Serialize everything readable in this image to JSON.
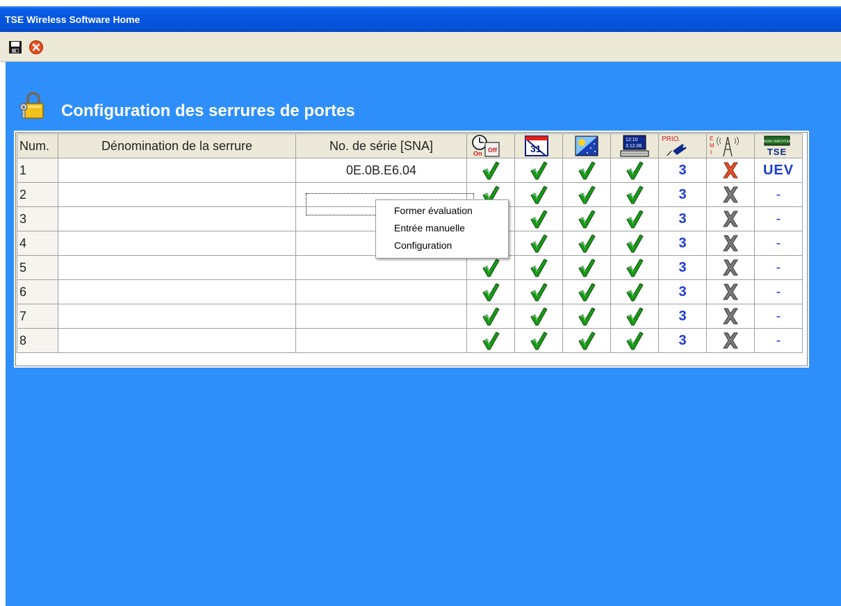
{
  "window": {
    "title": "TSE Wireless Software Home"
  },
  "toolbar": {
    "save_icon": "floppy-disk-icon",
    "close_icon": "close-circle-icon"
  },
  "page": {
    "title": "Configuration des serrures de portes",
    "icon": "padlock-keys-icon"
  },
  "table": {
    "headers": {
      "num": "Num.",
      "name": "Dénomination de la serrure",
      "serial": "No. de série [SNA]",
      "icon_columns": [
        "clock-on-off-icon",
        "calendar-31-icon",
        "sun-night-icon",
        "datetime-display-icon",
        "prio-tag-icon",
        "emi-antenna-icon",
        "tse-badge-icon"
      ],
      "prio_label": "PRIO.",
      "datetime_label_time": "12:10",
      "datetime_label_date": "3.12.06",
      "emi_label": "E\nM\nI",
      "tse_badge_top": "BURG WÄCHTER",
      "tse_label": "TSE",
      "clock_on": "On",
      "clock_off": "Off",
      "calendar_day": "31"
    },
    "rows": [
      {
        "num": "1",
        "name": "",
        "serial": "0E.0B.E6.04",
        "prio": "3",
        "emi_active": true,
        "tse": "UEV"
      },
      {
        "num": "2",
        "name": "",
        "serial": "",
        "prio": "3",
        "emi_active": false,
        "tse": "-"
      },
      {
        "num": "3",
        "name": "",
        "serial": "",
        "prio": "3",
        "emi_active": false,
        "tse": "-"
      },
      {
        "num": "4",
        "name": "",
        "serial": "",
        "prio": "3",
        "emi_active": false,
        "tse": "-"
      },
      {
        "num": "5",
        "name": "",
        "serial": "",
        "prio": "3",
        "emi_active": false,
        "tse": "-"
      },
      {
        "num": "6",
        "name": "",
        "serial": "",
        "prio": "3",
        "emi_active": false,
        "tse": "-"
      },
      {
        "num": "7",
        "name": "",
        "serial": "",
        "prio": "3",
        "emi_active": false,
        "tse": "-"
      },
      {
        "num": "8",
        "name": "",
        "serial": "",
        "prio": "3",
        "emi_active": false,
        "tse": "-"
      }
    ]
  },
  "context_menu": {
    "items": [
      "Former évaluation",
      "Entrée manuelle",
      "Configuration"
    ]
  },
  "colors": {
    "client_bg": "#2e8ffb",
    "title_bar": "#0654de",
    "check": "#1a9a1a",
    "cross_active": "#e0502a",
    "cross_inactive": "#7a7a7a",
    "prio_text": "#1a3bd6"
  }
}
